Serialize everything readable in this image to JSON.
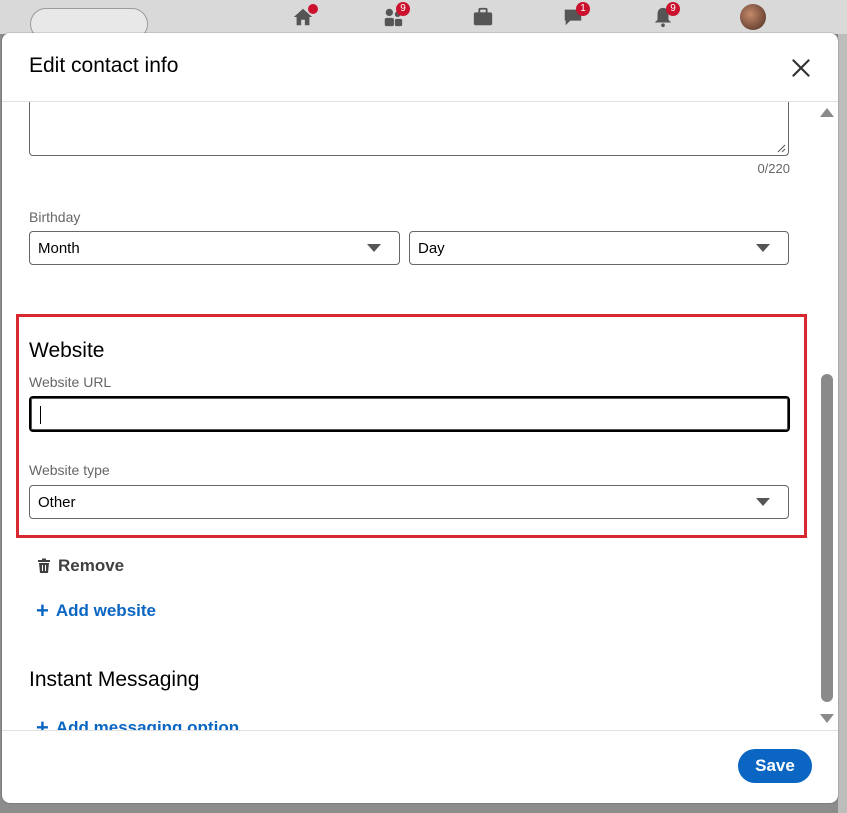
{
  "nav": {
    "badges": {
      "network": "9",
      "messaging": "1",
      "notifications": "9"
    }
  },
  "modal": {
    "title": "Edit contact info",
    "address_char_count": "0/220",
    "birthday": {
      "label": "Birthday",
      "month_value": "Month",
      "day_value": "Day"
    },
    "website": {
      "heading": "Website",
      "url_label": "Website URL",
      "url_value": "",
      "type_label": "Website type",
      "type_value": "Other",
      "remove_label": "Remove",
      "add_label": "Add website"
    },
    "instant_messaging": {
      "heading": "Instant Messaging",
      "add_label": "Add messaging option"
    },
    "save_label": "Save"
  },
  "colors": {
    "primary_blue": "#0a66c2",
    "highlight_red": "#d7282f",
    "badge_red": "#cb112d"
  }
}
